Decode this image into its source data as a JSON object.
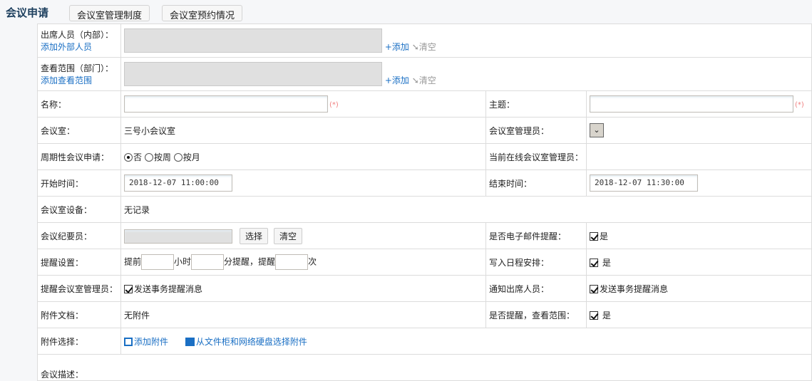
{
  "header": {
    "title": "会议申请",
    "buttons": [
      "会议室管理制度",
      "会议室预约情况"
    ]
  },
  "attendees": {
    "label": "出席人员（内部）：",
    "link": "添加外部人员",
    "add": "+添加",
    "clear": "清空"
  },
  "scope": {
    "label": "查看范围（部门）：",
    "link": "添加查看范围",
    "add": "+添加",
    "clear": "清空"
  },
  "required_mark": "(*)",
  "rows": {
    "name": "名称：",
    "subject": "主题：",
    "room": "会议室：",
    "room_value": "三号小会议室",
    "room_admin": "会议室管理员：",
    "periodic": "周期性会议申请：",
    "periodic_options": [
      "否",
      "按周",
      "按月"
    ],
    "online_admin": "当前在线会议室管理员：",
    "start": "开始时间：",
    "start_value": "2018-12-07 11:00:00",
    "end": "结束时间：",
    "end_value": "2018-12-07 11:30:00",
    "equipment": "会议室设备：",
    "equipment_value": "无记录",
    "recorder": "会议纪要员：",
    "select_btn": "选择",
    "clear_btn": "清空",
    "email": "是否电子邮件提醒：",
    "email_value": "是",
    "remind": "提醒设置：",
    "remind_before": "提前",
    "remind_hours": "小时",
    "remind_min": "分提醒，提醒",
    "remind_times": "次",
    "schedule": "写入日程安排：",
    "schedule_value": "是",
    "remind_admin": "提醒会议室管理员：",
    "remind_admin_value": "发送事务提醒消息",
    "notify": "通知出席人员：",
    "notify_value": "发送事务提醒消息",
    "attach_doc": "附件文档：",
    "attach_doc_value": "无附件",
    "remind_scope": "是否提醒，查看范围：",
    "remind_scope_value": "是",
    "attach_select": "附件选择：",
    "attach_add": "添加附件",
    "attach_disk": "从文件柜和网络硬盘选择附件",
    "desc": "会议描述："
  }
}
